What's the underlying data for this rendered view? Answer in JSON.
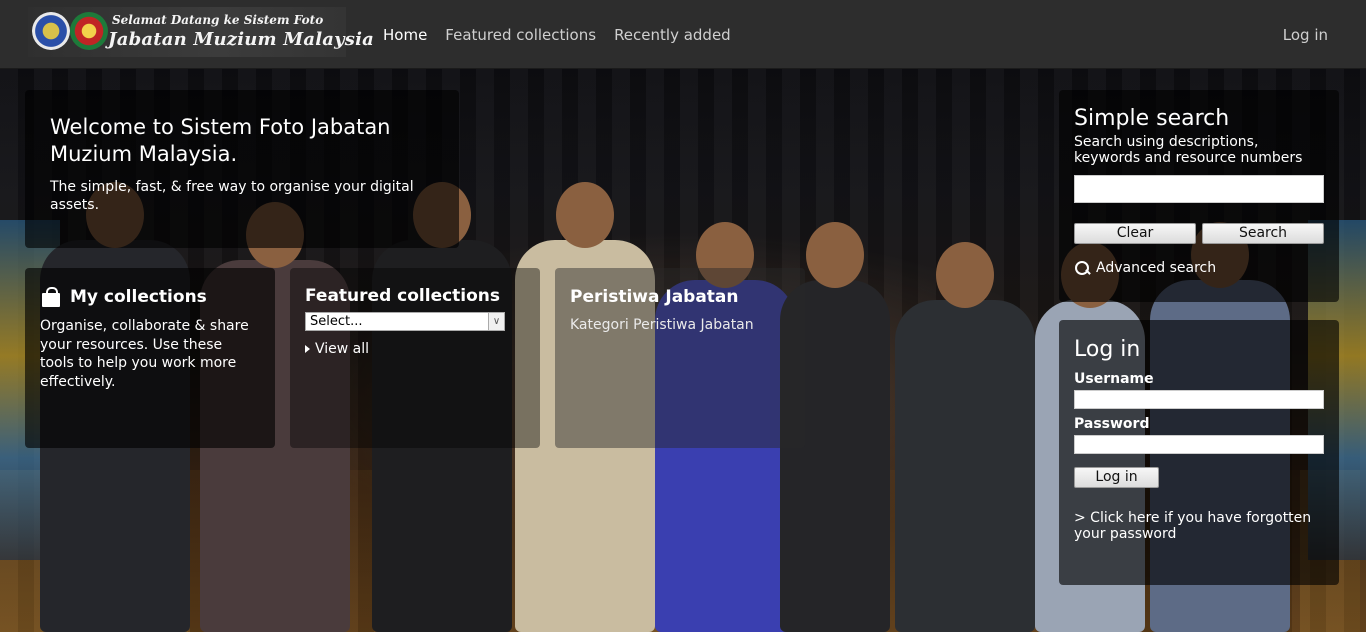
{
  "header": {
    "logo_line1": "Selamat Datang ke Sistem Foto",
    "logo_line2": "Jabatan Muzium Malaysia",
    "nav": [
      "Home",
      "Featured collections",
      "Recently added"
    ],
    "login_label": "Log in"
  },
  "welcome": {
    "title": "Welcome to Sistem Foto Jabatan Muzium Malaysia.",
    "subtitle": "The simple, fast, & free way to organise your digital assets."
  },
  "my_collections": {
    "title": "My collections",
    "text": "Organise, collaborate & share your resources. Use these tools to help you work more effectively."
  },
  "featured": {
    "title": "Featured collections",
    "select_value": "Select...",
    "view_all": "View all"
  },
  "peristiwa": {
    "title": "Peristiwa Jabatan",
    "text": "Kategori Peristiwa Jabatan"
  },
  "search": {
    "title": "Simple search",
    "description": "Search using descriptions, keywords and resource numbers",
    "clear_label": "Clear",
    "search_label": "Search",
    "advanced_label": "Advanced search"
  },
  "login": {
    "title": "Log in",
    "username_label": "Username",
    "password_label": "Password",
    "button_label": "Log in",
    "forgot_label": "> Click here if you have forgotten your password"
  }
}
